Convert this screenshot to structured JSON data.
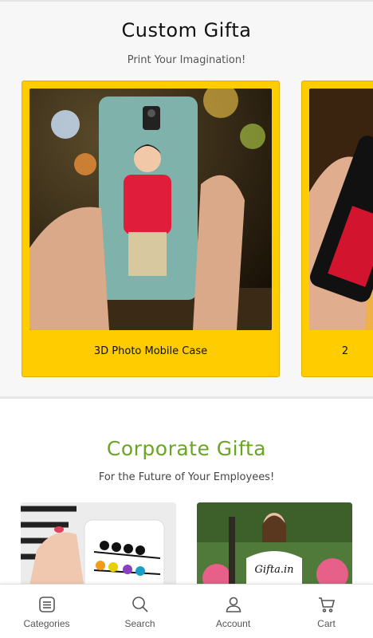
{
  "custom": {
    "title": "Custom Gifta",
    "subtitle": "Print Your Imagination!",
    "cards": [
      {
        "caption": "3D Photo Mobile Case"
      },
      {
        "caption": "2"
      }
    ]
  },
  "corporate": {
    "title": "Corporate Gifta",
    "subtitle": "For the Future of Your Employees!",
    "tshirt_text": "Gifta.in"
  },
  "nav": {
    "items": [
      {
        "label": "Categories",
        "icon": "list-icon"
      },
      {
        "label": "Search",
        "icon": "search-icon"
      },
      {
        "label": "Account",
        "icon": "user-icon"
      },
      {
        "label": "Cart",
        "icon": "cart-icon"
      }
    ]
  },
  "colors": {
    "card_yellow": "#ffcc00",
    "corporate_green": "#6aa524"
  }
}
